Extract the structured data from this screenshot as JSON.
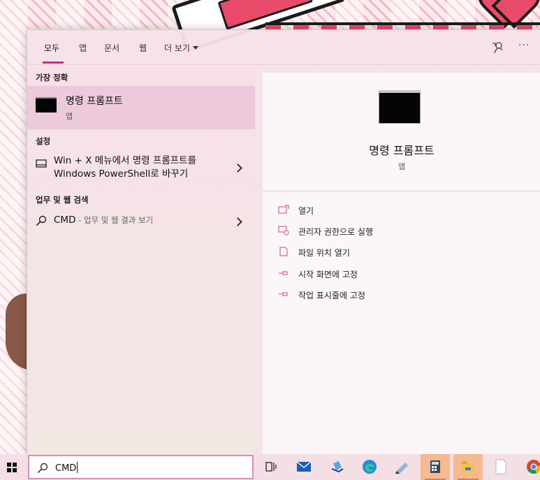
{
  "tabs": {
    "all": "모두",
    "apps": "앱",
    "documents": "문서",
    "web": "웹",
    "more": "더 보기"
  },
  "sections": {
    "best_match": "가장 정확",
    "settings": "설정",
    "web_search": "업무 및 웹 검색"
  },
  "best_result": {
    "title": "명령 프롬프트",
    "subtitle": "앱"
  },
  "settings_result": {
    "line1": "Win + X 메뉴에서 명령 프롬프트를",
    "line2": "Windows PowerShell로 바꾸기"
  },
  "web_result": {
    "query": "CMD",
    "hint": " - 업무 및 웹 결과 보기"
  },
  "preview": {
    "title": "명령 프롬프트",
    "subtitle": "앱",
    "actions": [
      {
        "label": "열기",
        "icon": "open-icon"
      },
      {
        "label": "관리자 권한으로 실행",
        "icon": "run-as-admin-icon"
      },
      {
        "label": "파일 위치 열기",
        "icon": "file-location-icon"
      },
      {
        "label": "시작 화면에 고정",
        "icon": "pin-to-start-icon"
      },
      {
        "label": "작업 표시줄에 고정",
        "icon": "pin-to-taskbar-icon"
      }
    ]
  },
  "search_box": {
    "value": "CMD"
  },
  "taskbar_icons": [
    "task-view-icon",
    "mail-icon",
    "store-icon",
    "edge-icon",
    "notepad-icon",
    "calculator-icon",
    "file-explorer-icon",
    "blank-file-icon",
    "chrome-icon"
  ],
  "colors": {
    "accent": "#c9327b",
    "selected_row": "#eccadb",
    "active_taskbar": "#f7b98f",
    "action_icon": "#d7639c"
  }
}
